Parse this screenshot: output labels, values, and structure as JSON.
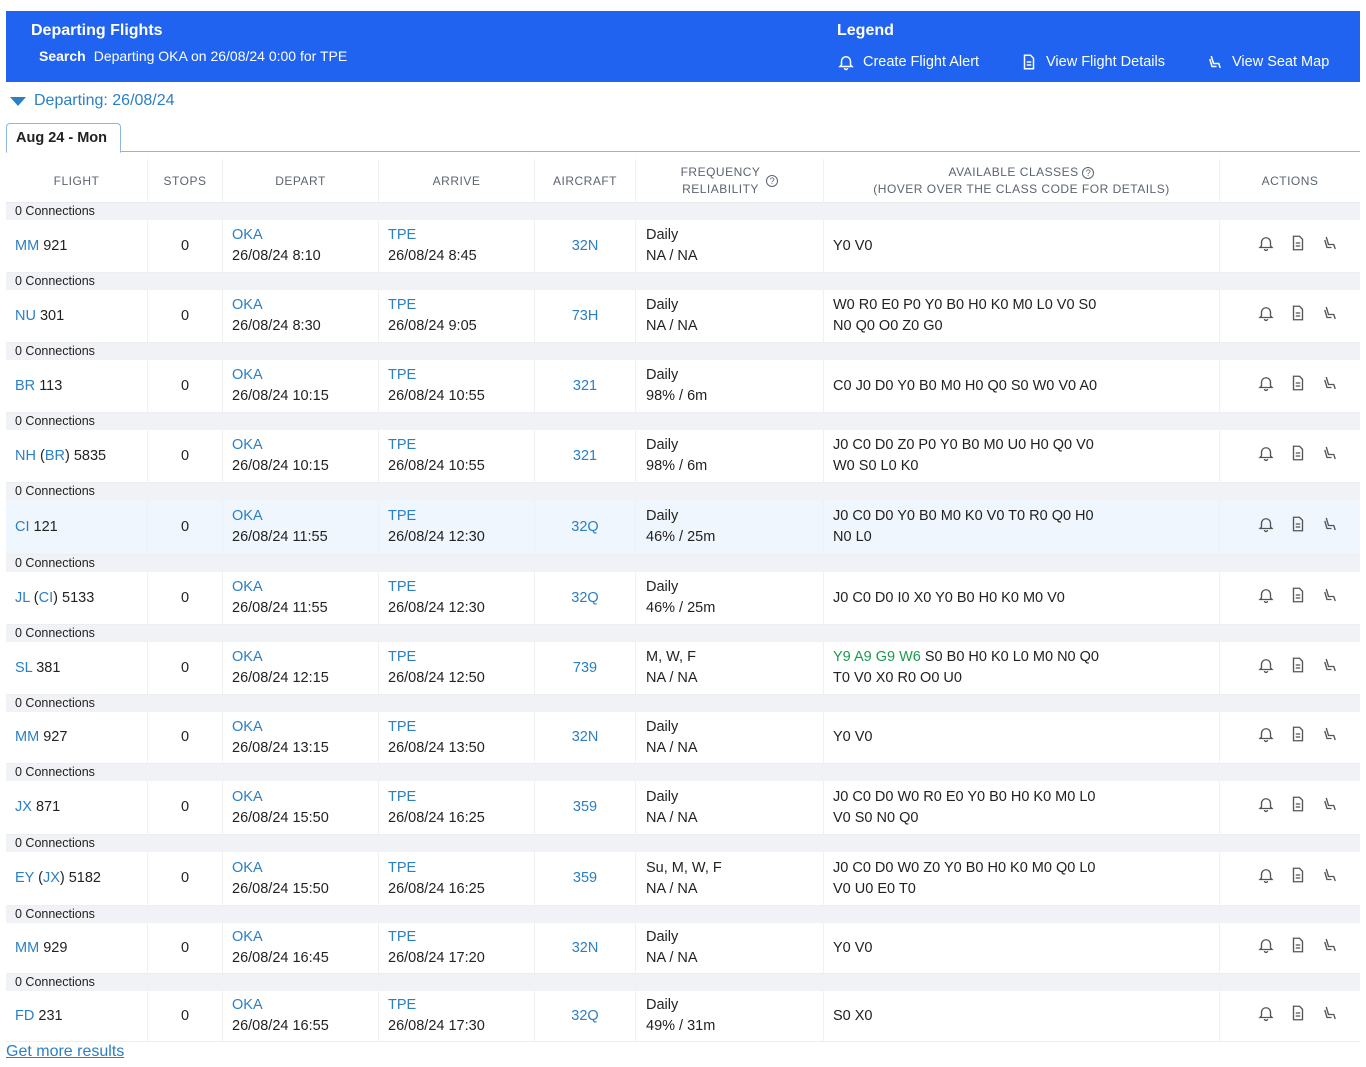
{
  "header": {
    "title": "Departing Flights",
    "search_label": "Search",
    "search_text": "Departing OKA on 26/08/24 0:00 for TPE",
    "legend_title": "Legend",
    "legend": {
      "alert": "Create Flight Alert",
      "details": "View Flight Details",
      "seatmap": "View Seat Map"
    }
  },
  "departing_label": "Departing: 26/08/24",
  "tab_label": "Aug 24 - Mon",
  "columns": {
    "flight": "FLIGHT",
    "stops": "STOPS",
    "depart": "DEPART",
    "arrive": "ARRIVE",
    "aircraft": "AIRCRAFT",
    "freq1": "FREQUENCY",
    "freq2": "RELIABILITY",
    "cls1": "AVAILABLE CLASSES",
    "cls2": "(HOVER OVER THE CLASS CODE FOR DETAILS)",
    "actions": "ACTIONS"
  },
  "connections_label": "0 Connections",
  "flights": [
    {
      "airline": "MM",
      "op": "",
      "num": "921",
      "stops": "0",
      "dep_code": "OKA",
      "dep_time": "26/08/24 8:10",
      "arr_code": "TPE",
      "arr_time": "26/08/24 8:45",
      "aircraft": "32N",
      "freq": "Daily",
      "rel": "NA / NA",
      "green": "",
      "cls1": "Y0 V0",
      "cls2": ""
    },
    {
      "airline": "NU",
      "op": "",
      "num": "301",
      "stops": "0",
      "dep_code": "OKA",
      "dep_time": "26/08/24 8:30",
      "arr_code": "TPE",
      "arr_time": "26/08/24 9:05",
      "aircraft": "73H",
      "freq": "Daily",
      "rel": "NA / NA",
      "green": "",
      "cls1": "W0 R0 E0 P0 Y0 B0 H0 K0 M0 L0 V0 S0",
      "cls2": "N0 Q0 O0 Z0 G0"
    },
    {
      "airline": "BR",
      "op": "",
      "num": "113",
      "stops": "0",
      "dep_code": "OKA",
      "dep_time": "26/08/24 10:15",
      "arr_code": "TPE",
      "arr_time": "26/08/24 10:55",
      "aircraft": "321",
      "freq": "Daily",
      "rel": "98% / 6m",
      "green": "",
      "cls1": "C0 J0 D0 Y0 B0 M0 H0 Q0 S0 W0 V0 A0",
      "cls2": ""
    },
    {
      "airline": "NH",
      "op": "BR",
      "num": "5835",
      "stops": "0",
      "dep_code": "OKA",
      "dep_time": "26/08/24 10:15",
      "arr_code": "TPE",
      "arr_time": "26/08/24 10:55",
      "aircraft": "321",
      "freq": "Daily",
      "rel": "98% / 6m",
      "green": "",
      "cls1": "J0 C0 D0 Z0 P0 Y0 B0 M0 U0 H0 Q0 V0",
      "cls2": "W0 S0 L0 K0"
    },
    {
      "airline": "CI",
      "op": "",
      "num": "121",
      "stops": "0",
      "dep_code": "OKA",
      "dep_time": "26/08/24 11:55",
      "arr_code": "TPE",
      "arr_time": "26/08/24 12:30",
      "aircraft": "32Q",
      "freq": "Daily",
      "rel": "46% / 25m",
      "green": "",
      "cls1": "J0 C0 D0 Y0 B0 M0 K0 V0 T0 R0 Q0 H0",
      "cls2": "N0 L0",
      "hl": true
    },
    {
      "airline": "JL",
      "op": "CI",
      "num": "5133",
      "stops": "0",
      "dep_code": "OKA",
      "dep_time": "26/08/24 11:55",
      "arr_code": "TPE",
      "arr_time": "26/08/24 12:30",
      "aircraft": "32Q",
      "freq": "Daily",
      "rel": "46% / 25m",
      "green": "",
      "cls1": "J0 C0 D0 I0 X0 Y0 B0 H0 K0 M0 V0",
      "cls2": ""
    },
    {
      "airline": "SL",
      "op": "",
      "num": "381",
      "stops": "0",
      "dep_code": "OKA",
      "dep_time": "26/08/24 12:15",
      "arr_code": "TPE",
      "arr_time": "26/08/24 12:50",
      "aircraft": "739",
      "freq": "M, W, F",
      "rel": "NA / NA",
      "green": "Y9 A9 G9 W6",
      "cls1": "S0 B0 H0 K0 L0 M0 N0 Q0",
      "cls2": "T0 V0 X0 R0 O0 U0"
    },
    {
      "airline": "MM",
      "op": "",
      "num": "927",
      "stops": "0",
      "dep_code": "OKA",
      "dep_time": "26/08/24 13:15",
      "arr_code": "TPE",
      "arr_time": "26/08/24 13:50",
      "aircraft": "32N",
      "freq": "Daily",
      "rel": "NA / NA",
      "green": "",
      "cls1": "Y0 V0",
      "cls2": ""
    },
    {
      "airline": "JX",
      "op": "",
      "num": "871",
      "stops": "0",
      "dep_code": "OKA",
      "dep_time": "26/08/24 15:50",
      "arr_code": "TPE",
      "arr_time": "26/08/24 16:25",
      "aircraft": "359",
      "freq": "Daily",
      "rel": "NA / NA",
      "green": "",
      "cls1": "J0 C0 D0 W0 R0 E0 Y0 B0 H0 K0 M0 L0",
      "cls2": "V0 S0 N0 Q0"
    },
    {
      "airline": "EY",
      "op": "JX",
      "num": "5182",
      "stops": "0",
      "dep_code": "OKA",
      "dep_time": "26/08/24 15:50",
      "arr_code": "TPE",
      "arr_time": "26/08/24 16:25",
      "aircraft": "359",
      "freq": "Su, M, W, F",
      "rel": "NA / NA",
      "green": "",
      "cls1": "J0 C0 D0 W0 Z0 Y0 B0 H0 K0 M0 Q0 L0",
      "cls2": "V0 U0 E0 T0"
    },
    {
      "airline": "MM",
      "op": "",
      "num": "929",
      "stops": "0",
      "dep_code": "OKA",
      "dep_time": "26/08/24 16:45",
      "arr_code": "TPE",
      "arr_time": "26/08/24 17:20",
      "aircraft": "32N",
      "freq": "Daily",
      "rel": "NA / NA",
      "green": "",
      "cls1": "Y0 V0",
      "cls2": ""
    },
    {
      "airline": "FD",
      "op": "",
      "num": "231",
      "stops": "0",
      "dep_code": "OKA",
      "dep_time": "26/08/24 16:55",
      "arr_code": "TPE",
      "arr_time": "26/08/24 17:30",
      "aircraft": "32Q",
      "freq": "Daily",
      "rel": "49% / 31m",
      "green": "",
      "cls1": "S0 X0",
      "cls2": ""
    }
  ],
  "more_label": "Get more results",
  "colors": {
    "header": "#1f63f0",
    "link": "#2b7fc3",
    "green": "#1a9a4f",
    "highlight": "#f0f6fd"
  }
}
